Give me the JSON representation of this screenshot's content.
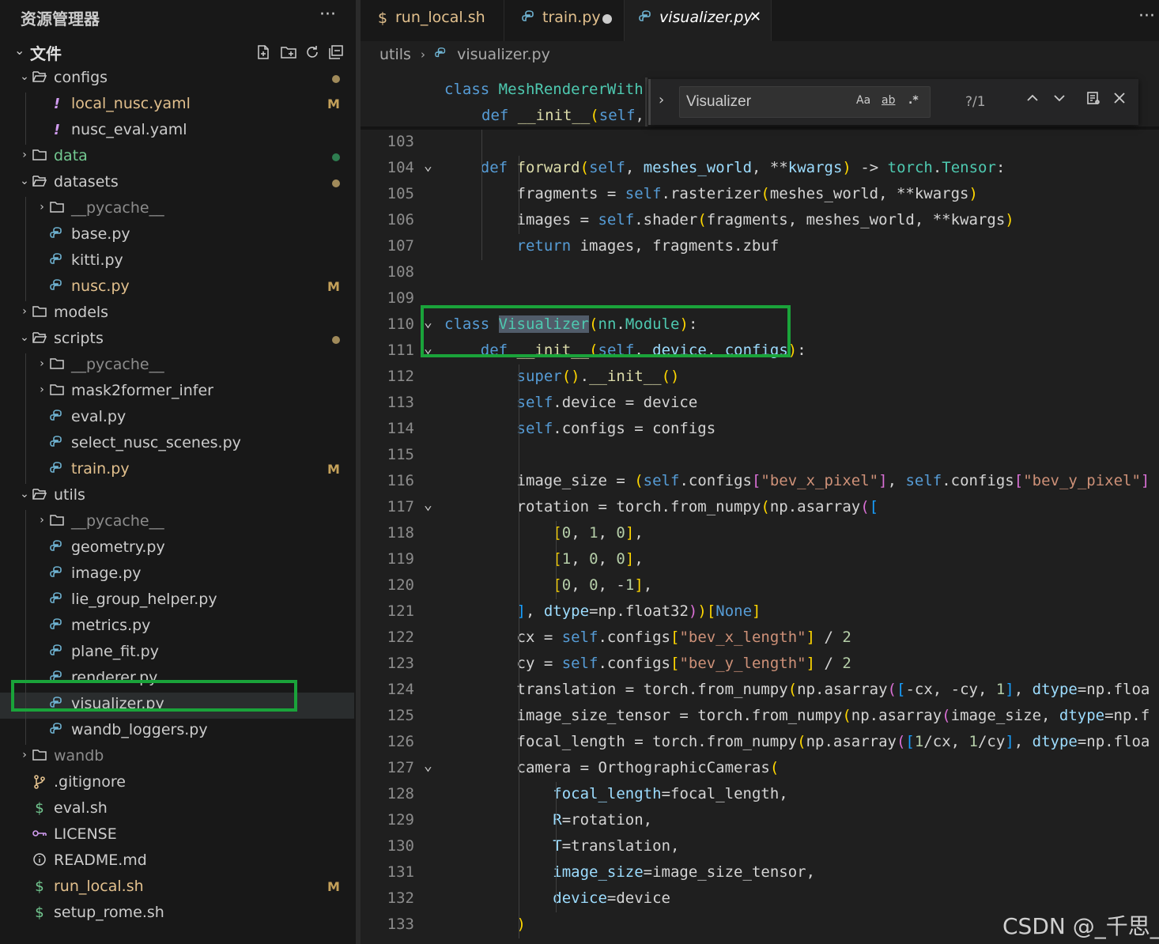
{
  "explorer": {
    "title": "资源管理器",
    "more": "···",
    "section": "文件",
    "actions": [
      "new-file-icon",
      "new-folder-icon",
      "refresh-icon",
      "collapse-all-icon"
    ]
  },
  "colors": {
    "accent_box": "#1aa33a",
    "modified": "#e2c08d",
    "untracked": "#73c991",
    "badge": "#c4a15a"
  },
  "tree": [
    {
      "label": "configs",
      "kind": "folder-open",
      "depth": 0,
      "dot": "#a08a5a"
    },
    {
      "label": "local_nusc.yaml",
      "kind": "yaml",
      "depth": 1,
      "badge": "M",
      "state": "modified"
    },
    {
      "label": "nusc_eval.yaml",
      "kind": "yaml",
      "depth": 1
    },
    {
      "label": "data",
      "kind": "folder",
      "depth": 0,
      "dot": "#2e7d50",
      "state": "untracked"
    },
    {
      "label": "datasets",
      "kind": "folder-open",
      "depth": 0,
      "dot": "#a08a5a"
    },
    {
      "label": "__pycache__",
      "kind": "folder",
      "depth": 1,
      "state": "ignored"
    },
    {
      "label": "base.py",
      "kind": "py",
      "depth": 1
    },
    {
      "label": "kitti.py",
      "kind": "py",
      "depth": 1
    },
    {
      "label": "nusc.py",
      "kind": "py",
      "depth": 1,
      "badge": "M",
      "state": "modified"
    },
    {
      "label": "models",
      "kind": "folder",
      "depth": 0
    },
    {
      "label": "scripts",
      "kind": "folder-open",
      "depth": 0,
      "dot": "#a08a5a"
    },
    {
      "label": "__pycache__",
      "kind": "folder",
      "depth": 1,
      "state": "ignored"
    },
    {
      "label": "mask2former_infer",
      "kind": "folder",
      "depth": 1
    },
    {
      "label": "eval.py",
      "kind": "py",
      "depth": 1
    },
    {
      "label": "select_nusc_scenes.py",
      "kind": "py",
      "depth": 1
    },
    {
      "label": "train.py",
      "kind": "py",
      "depth": 1,
      "badge": "M",
      "state": "modified"
    },
    {
      "label": "utils",
      "kind": "folder-open",
      "depth": 0
    },
    {
      "label": "__pycache__",
      "kind": "folder",
      "depth": 1,
      "state": "ignored"
    },
    {
      "label": "geometry.py",
      "kind": "py",
      "depth": 1
    },
    {
      "label": "image.py",
      "kind": "py",
      "depth": 1
    },
    {
      "label": "lie_group_helper.py",
      "kind": "py",
      "depth": 1
    },
    {
      "label": "metrics.py",
      "kind": "py",
      "depth": 1
    },
    {
      "label": "plane_fit.py",
      "kind": "py",
      "depth": 1
    },
    {
      "label": "renderer.py",
      "kind": "py",
      "depth": 1
    },
    {
      "label": "visualizer.py",
      "kind": "py",
      "depth": 1,
      "selected": true
    },
    {
      "label": "wandb_loggers.py",
      "kind": "py",
      "depth": 1
    },
    {
      "label": "wandb",
      "kind": "folder",
      "depth": 0,
      "state": "ignored"
    },
    {
      "label": ".gitignore",
      "kind": "git",
      "depth": 0
    },
    {
      "label": "eval.sh",
      "kind": "sh",
      "depth": 0
    },
    {
      "label": "LICENSE",
      "kind": "license",
      "depth": 0
    },
    {
      "label": "README.md",
      "kind": "info",
      "depth": 0
    },
    {
      "label": "run_local.sh",
      "kind": "sh",
      "depth": 0,
      "badge": "M",
      "state": "modified"
    },
    {
      "label": "setup_rome.sh",
      "kind": "sh",
      "depth": 0
    }
  ],
  "tabs": [
    {
      "label": "run_local.sh",
      "kind": "sh",
      "state": "modified"
    },
    {
      "label": "train.py",
      "kind": "py",
      "state": "modified",
      "dirty": true
    },
    {
      "label": "visualizer.py",
      "kind": "py",
      "active": true,
      "close": "✕"
    }
  ],
  "tabbar_more": "···",
  "breadcrumb": [
    "utils",
    "visualizer.py"
  ],
  "sticky": [
    {
      "text": "class MeshRendererWith",
      "indent": 0
    },
    {
      "text": "def __init__(self,",
      "indent": 1
    }
  ],
  "find": {
    "value": "Visualizer",
    "match_case": "Aa",
    "whole_word": "ab",
    "regex": ".*",
    "count": "?/1"
  },
  "code": [
    {
      "n": "103",
      "fold": false,
      "html": ""
    },
    {
      "n": "104",
      "fold": true,
      "html": "    <span class='kw'>def</span> <span class='fn'>forward</span><span class='b1'>(</span><span class='self'>self</span>, <span class='par'>meshes_world</span>, **<span class='par'>kwargs</span><span class='b1'>)</span> -&gt; <span class='cls'>torch</span>.<span class='cls'>Tensor</span>:"
    },
    {
      "n": "105",
      "fold": false,
      "html": "        fragments = <span class='self'>self</span>.rasterizer<span class='b1'>(</span>meshes_world, **kwargs<span class='b1'>)</span>"
    },
    {
      "n": "106",
      "fold": false,
      "html": "        images = <span class='self'>self</span>.shader<span class='b1'>(</span>fragments, meshes_world, **kwargs<span class='b1'>)</span>"
    },
    {
      "n": "107",
      "fold": false,
      "html": "        <span class='kw'>return</span> images, fragments.zbuf"
    },
    {
      "n": "108",
      "fold": false,
      "html": ""
    },
    {
      "n": "109",
      "fold": false,
      "html": ""
    },
    {
      "n": "110",
      "fold": true,
      "html": "<span class='kw'>class</span> <span class='cls hl'>Visualizer</span><span class='b1'>(</span><span class='cls'>nn</span>.<span class='cls'>Module</span><span class='b1'>)</span>:"
    },
    {
      "n": "111",
      "fold": true,
      "html": "    <span class='kw'>def</span> <span class='fn'>__init__</span><span class='b1'>(</span><span class='self'>self</span>, <span class='par'>device</span>, <span class='par'>configs</span><span class='b1'>)</span>:"
    },
    {
      "n": "112",
      "fold": false,
      "html": "        <span class='kw'>super</span><span class='b1'>()</span>.<span class='fn'>__init__</span><span class='b1'>()</span>"
    },
    {
      "n": "113",
      "fold": false,
      "html": "        <span class='self'>self</span>.device = device"
    },
    {
      "n": "114",
      "fold": false,
      "html": "        <span class='self'>self</span>.configs = configs"
    },
    {
      "n": "115",
      "fold": false,
      "html": ""
    },
    {
      "n": "116",
      "fold": false,
      "html": "        image_size = <span class='b1'>(</span><span class='self'>self</span>.configs<span class='b2'>[</span><span class='str'>\"bev_x_pixel\"</span><span class='b2'>]</span>, <span class='self'>self</span>.configs<span class='b2'>[</span><span class='str'>\"bev_y_pixel\"</span><span class='b2'>]</span>"
    },
    {
      "n": "117",
      "fold": true,
      "html": "        rotation = torch.from_numpy<span class='b1'>(</span>np.asarray<span class='b2'>(</span><span class='b3'>[</span>"
    },
    {
      "n": "118",
      "fold": false,
      "html": "            <span class='b1'>[</span><span class='num'>0</span>, <span class='num'>1</span>, <span class='num'>0</span><span class='b1'>]</span>,"
    },
    {
      "n": "119",
      "fold": false,
      "html": "            <span class='b1'>[</span><span class='num'>1</span>, <span class='num'>0</span>, <span class='num'>0</span><span class='b1'>]</span>,"
    },
    {
      "n": "120",
      "fold": false,
      "html": "            <span class='b1'>[</span><span class='num'>0</span>, <span class='num'>0</span>, -<span class='num'>1</span><span class='b1'>]</span>,"
    },
    {
      "n": "121",
      "fold": false,
      "html": "        <span class='b3'>]</span>, <span class='par'>dtype</span>=np.float32<span class='b2'>)</span><span class='b1'>)</span><span class='b1'>[</span><span class='kw'>None</span><span class='b1'>]</span>"
    },
    {
      "n": "122",
      "fold": false,
      "html": "        cx = <span class='self'>self</span>.configs<span class='b1'>[</span><span class='str'>\"bev_x_length\"</span><span class='b1'>]</span> / <span class='num'>2</span>"
    },
    {
      "n": "123",
      "fold": false,
      "html": "        cy = <span class='self'>self</span>.configs<span class='b1'>[</span><span class='str'>\"bev_y_length\"</span><span class='b1'>]</span> / <span class='num'>2</span>"
    },
    {
      "n": "124",
      "fold": false,
      "html": "        translation = torch.from_numpy<span class='b1'>(</span>np.asarray<span class='b2'>(</span><span class='b3'>[</span>-cx, -cy, <span class='num'>1</span><span class='b3'>]</span>, <span class='par'>dtype</span>=np.floa"
    },
    {
      "n": "125",
      "fold": false,
      "html": "        image_size_tensor = torch.from_numpy<span class='b1'>(</span>np.asarray<span class='b2'>(</span>image_size, <span class='par'>dtype</span>=np.f"
    },
    {
      "n": "126",
      "fold": false,
      "html": "        focal_length = torch.from_numpy<span class='b1'>(</span>np.asarray<span class='b2'>(</span><span class='b3'>[</span><span class='num'>1</span>/cx, <span class='num'>1</span>/cy<span class='b3'>]</span>, <span class='par'>dtype</span>=np.floa"
    },
    {
      "n": "127",
      "fold": true,
      "html": "        camera = OrthographicCameras<span class='b1'>(</span>"
    },
    {
      "n": "128",
      "fold": false,
      "html": "            <span class='par'>focal_length</span>=focal_length,"
    },
    {
      "n": "129",
      "fold": false,
      "html": "            <span class='par'>R</span>=rotation,"
    },
    {
      "n": "130",
      "fold": false,
      "html": "            <span class='par'>T</span>=translation,"
    },
    {
      "n": "131",
      "fold": false,
      "html": "            <span class='par'>image_size</span>=image_size_tensor,"
    },
    {
      "n": "132",
      "fold": false,
      "html": "            <span class='par'>device</span>=device"
    },
    {
      "n": "133",
      "fold": false,
      "html": "        <span class='b1'>)</span>"
    }
  ],
  "watermark": "CSDN @_千思_"
}
